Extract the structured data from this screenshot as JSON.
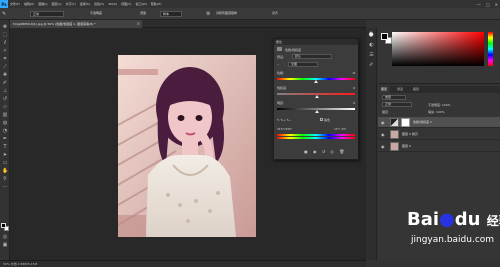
{
  "menubar": {
    "logo": "Ps",
    "items": [
      "文件(F)",
      "编辑(E)",
      "图像(I)",
      "图层(L)",
      "文字(Y)",
      "选择(S)",
      "滤镜(T)",
      "3D(D)",
      "视图(V)",
      "窗口(W)",
      "帮助(H)"
    ],
    "minimize": "—",
    "maximize": "▢",
    "close": "✕"
  },
  "options": {
    "mode": "正常",
    "opacity_label": "不透明度",
    "flow_label": "流量",
    "sample_label": "样本",
    "check_label": "对所有图层取样",
    "extra_label": "对齐"
  },
  "document": {
    "tab_title": "5mjs98959-8(1).jpg @ 50% (色相/饱和度 1, 图层蒙版/8) *",
    "tab_close": "×",
    "status": "50%     文档:2.58M/5.15M"
  },
  "properties": {
    "title": "属性",
    "subtitle": "色相/饱和度",
    "preset_label": "预设:",
    "preset_value": "默认",
    "channel_value": "全图",
    "hue_label": "色相:",
    "hue_value": "-8",
    "hue_level": 0.48,
    "saturation_label": "饱和度:",
    "saturation_value": "0",
    "saturation_level": 0.5,
    "lightness_label": "明度:",
    "lightness_value": "0",
    "lightness_level": 0.5,
    "colorize_label": "着色",
    "range_left": "315°/345°",
    "range_right": "15°\\ 45°"
  },
  "layers": {
    "tabs": [
      "图层",
      "通道",
      "路径"
    ],
    "kind_label": "类型",
    "blend_mode": "正常",
    "opacity_label": "不透明度: 100%",
    "fill_label": "填充: 100%",
    "lock_label": "锁定:",
    "rows": [
      {
        "name": "色相/饱和度 1",
        "type": "adjustment"
      },
      {
        "name": "图层 0 拷贝",
        "type": "pixel"
      },
      {
        "name": "图层 0",
        "type": "pixel"
      }
    ]
  },
  "watermark": {
    "brand": "Bai",
    "paw": "du",
    "suffix": "经验",
    "url": "jingyan.baidu.com"
  },
  "colors": {
    "accent": "#31a8ff",
    "foreground": "#000000",
    "background": "#ffffff"
  }
}
